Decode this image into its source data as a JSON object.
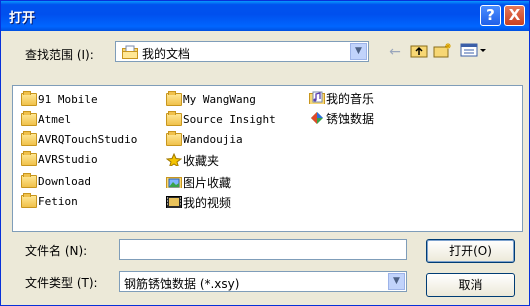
{
  "window": {
    "title": "打开"
  },
  "titlebar": {
    "help_glyph": "?",
    "close_glyph": "X"
  },
  "look_in": {
    "label": "查找范围 (I):",
    "value": "我的文档"
  },
  "toolbar": {
    "back_icon": "←",
    "up_icon": "up-folder-icon",
    "new_folder_icon": "new-folder-icon",
    "view_menu_icon": "view-menu-icon"
  },
  "files": [
    {
      "name": "91 Mobile",
      "icon": "folder-icon",
      "cjk": false
    },
    {
      "name": "Atmel",
      "icon": "folder-icon",
      "cjk": false
    },
    {
      "name": "AVRQTouchStudio",
      "icon": "folder-icon",
      "cjk": false
    },
    {
      "name": "AVRStudio",
      "icon": "folder-icon",
      "cjk": false
    },
    {
      "name": "Download",
      "icon": "folder-icon",
      "cjk": false
    },
    {
      "name": "Fetion",
      "icon": "folder-icon",
      "cjk": false
    },
    {
      "name": "My WangWang",
      "icon": "folder-icon",
      "cjk": false
    },
    {
      "name": "Source Insight",
      "icon": "folder-icon",
      "cjk": false
    },
    {
      "name": "Wandoujia",
      "icon": "folder-icon",
      "cjk": false
    },
    {
      "name": "收藏夹",
      "icon": "star-folder-icon",
      "cjk": true
    },
    {
      "name": "图片收藏",
      "icon": "pictures-folder-icon",
      "cjk": true
    },
    {
      "name": "我的视频",
      "icon": "videos-folder-icon",
      "cjk": true
    },
    {
      "name": "我的音乐",
      "icon": "music-folder-icon",
      "cjk": true
    },
    {
      "name": "锈蚀数据",
      "icon": "data-file-icon",
      "cjk": true
    }
  ],
  "file_name": {
    "label": "文件名 (N):",
    "value": ""
  },
  "file_type": {
    "label": "文件类型 (T):",
    "value": "钢筋锈蚀数据 (*.xsy)"
  },
  "buttons": {
    "open": "打开(O)",
    "cancel": "取消"
  },
  "colors": {
    "title_bar": "#0053ee",
    "dialog_bg": "#ece9d8",
    "border": "#7f9db9",
    "close_red": "#c94020"
  }
}
